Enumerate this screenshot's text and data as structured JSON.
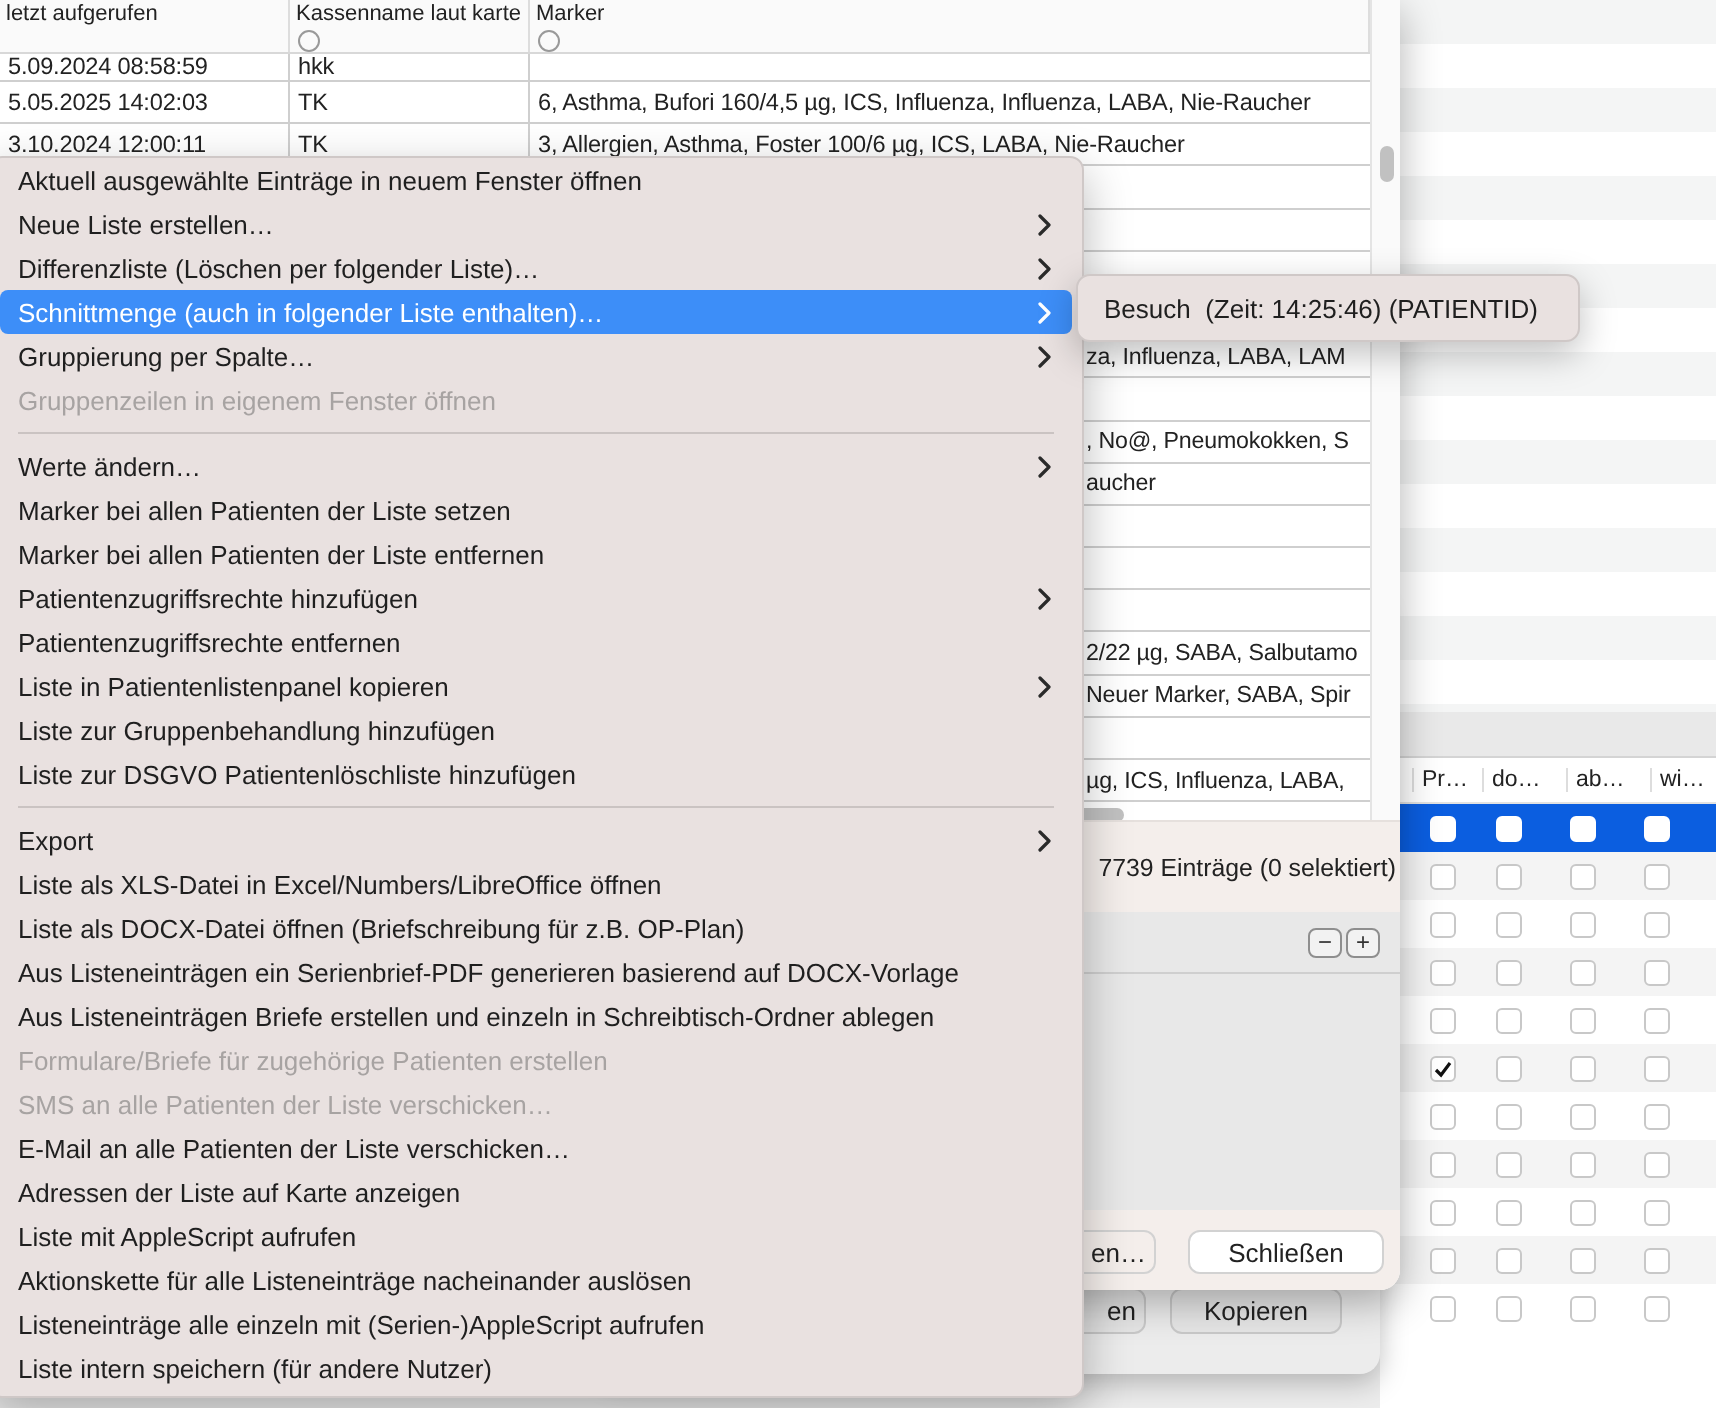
{
  "back_window": {
    "columns": [
      "Pr…",
      "do…",
      "ab…",
      "wi…"
    ],
    "rows": [
      {
        "selected": true,
        "checks": [
          false,
          false,
          false,
          false
        ]
      },
      {
        "selected": false,
        "checks": [
          false,
          false,
          false,
          false
        ]
      },
      {
        "selected": false,
        "checks": [
          false,
          false,
          false,
          false
        ]
      },
      {
        "selected": false,
        "checks": [
          false,
          false,
          false,
          false
        ]
      },
      {
        "selected": false,
        "checks": [
          false,
          false,
          false,
          false
        ]
      },
      {
        "selected": false,
        "checks": [
          true,
          false,
          false,
          false
        ]
      },
      {
        "selected": false,
        "checks": [
          false,
          false,
          false,
          false
        ]
      },
      {
        "selected": false,
        "checks": [
          false,
          false,
          false,
          false
        ]
      },
      {
        "selected": false,
        "checks": [
          false,
          false,
          false,
          false
        ]
      },
      {
        "selected": false,
        "checks": [
          false,
          false,
          false,
          false
        ]
      },
      {
        "selected": false,
        "checks": [
          false,
          false,
          false,
          false
        ]
      }
    ]
  },
  "middle_window": {
    "buttons": [
      "en",
      "Kopieren"
    ]
  },
  "dialog": {
    "columns": [
      "letzt aufgerufen",
      "Kassenname laut karte",
      "Marker"
    ],
    "rows": [
      {
        "kind": "full",
        "date": "5.09.2024 08:58:59",
        "kasse": "hkk"
      },
      {
        "kind": "full",
        "date": "5.05.2025 14:02:03",
        "kasse": "TK",
        "marker": "6, Asthma, Bufori 160/4,5 µg, ICS, Influenza, Influenza, LABA, Nie-Raucher"
      },
      {
        "kind": "full",
        "date": "3.10.2024 12:00:11",
        "kasse": "TK",
        "marker": "3, Allergien, Asthma, Foster 100/6 µg, ICS, LABA, Nie-Raucher"
      },
      {
        "kind": "blank"
      },
      {
        "kind": "blank"
      },
      {
        "kind": "blank"
      },
      {
        "kind": "blank"
      },
      {
        "kind": "partial",
        "marker": "za, Influenza, LABA, LAM"
      },
      {
        "kind": "blank"
      },
      {
        "kind": "partial",
        "marker": ", No@, Pneumokokken, S"
      },
      {
        "kind": "partial",
        "marker": "aucher"
      },
      {
        "kind": "blank"
      },
      {
        "kind": "blank"
      },
      {
        "kind": "blank"
      },
      {
        "kind": "partial",
        "marker": "2/22 µg, SABA, Salbutamo"
      },
      {
        "kind": "partial",
        "marker": "Neuer Marker, SABA, Spir"
      },
      {
        "kind": "blank"
      },
      {
        "kind": "partial",
        "marker": "µg, ICS, Influenza, LABA,"
      }
    ],
    "status": "7739 Einträge (0 selektiert)",
    "tool_buttons": [
      "−",
      "+"
    ],
    "buttons": [
      "en…",
      "Schließen"
    ]
  },
  "menu": {
    "items": [
      {
        "kind": "item",
        "label": "Aktuell ausgewählte Einträge in neuem Fenster öffnen",
        "submenu": false,
        "disabled": false,
        "selected": false
      },
      {
        "kind": "item",
        "label": "Neue Liste erstellen…",
        "submenu": true,
        "disabled": false,
        "selected": false
      },
      {
        "kind": "item",
        "label": "Differenzliste (Löschen per folgender Liste)…",
        "submenu": true,
        "disabled": false,
        "selected": false
      },
      {
        "kind": "item",
        "label": "Schnittmenge (auch in folgender Liste enthalten)…",
        "submenu": true,
        "disabled": false,
        "selected": true
      },
      {
        "kind": "item",
        "label": "Gruppierung per Spalte…",
        "submenu": true,
        "disabled": false,
        "selected": false
      },
      {
        "kind": "item",
        "label": "Gruppenzeilen in eigenem Fenster öffnen",
        "submenu": false,
        "disabled": true,
        "selected": false
      },
      {
        "kind": "separator"
      },
      {
        "kind": "item",
        "label": "Werte ändern…",
        "submenu": true,
        "disabled": false,
        "selected": false
      },
      {
        "kind": "item",
        "label": "Marker bei allen Patienten der Liste setzen",
        "submenu": false,
        "disabled": false,
        "selected": false
      },
      {
        "kind": "item",
        "label": "Marker bei allen Patienten der Liste entfernen",
        "submenu": false,
        "disabled": false,
        "selected": false
      },
      {
        "kind": "item",
        "label": "Patientenzugriffsrechte hinzufügen",
        "submenu": true,
        "disabled": false,
        "selected": false
      },
      {
        "kind": "item",
        "label": "Patientenzugriffsrechte entfernen",
        "submenu": false,
        "disabled": false,
        "selected": false
      },
      {
        "kind": "item",
        "label": "Liste in Patientenlistenpanel kopieren",
        "submenu": true,
        "disabled": false,
        "selected": false
      },
      {
        "kind": "item",
        "label": "Liste zur Gruppenbehandlung hinzufügen",
        "submenu": false,
        "disabled": false,
        "selected": false
      },
      {
        "kind": "item",
        "label": "Liste zur DSGVO Patientenlöschliste hinzufügen",
        "submenu": false,
        "disabled": false,
        "selected": false
      },
      {
        "kind": "separator"
      },
      {
        "kind": "item",
        "label": "Export",
        "submenu": true,
        "disabled": false,
        "selected": false
      },
      {
        "kind": "item",
        "label": "Liste als XLS-Datei in Excel/Numbers/LibreOffice öffnen",
        "submenu": false,
        "disabled": false,
        "selected": false
      },
      {
        "kind": "item",
        "label": "Liste als DOCX-Datei öffnen (Briefschreibung für z.B. OP-Plan)",
        "submenu": false,
        "disabled": false,
        "selected": false
      },
      {
        "kind": "item",
        "label": "Aus Listeneinträgen ein Serienbrief-PDF generieren basierend auf DOCX-Vorlage",
        "submenu": false,
        "disabled": false,
        "selected": false
      },
      {
        "kind": "item",
        "label": "Aus Listeneinträgen Briefe erstellen und einzeln in Schreibtisch-Ordner ablegen",
        "submenu": false,
        "disabled": false,
        "selected": false
      },
      {
        "kind": "item",
        "label": "Formulare/Briefe für zugehörige Patienten erstellen",
        "submenu": false,
        "disabled": true,
        "selected": false
      },
      {
        "kind": "item",
        "label": "SMS an alle Patienten der Liste verschicken…",
        "submenu": false,
        "disabled": true,
        "selected": false
      },
      {
        "kind": "item",
        "label": "E-Mail an alle Patienten der Liste verschicken…",
        "submenu": false,
        "disabled": false,
        "selected": false
      },
      {
        "kind": "item",
        "label": "Adressen der Liste auf Karte anzeigen",
        "submenu": false,
        "disabled": false,
        "selected": false
      },
      {
        "kind": "item",
        "label": "Liste mit AppleScript aufrufen",
        "submenu": false,
        "disabled": false,
        "selected": false
      },
      {
        "kind": "item",
        "label": "Aktionskette für alle Listeneinträge nacheinander auslösen",
        "submenu": false,
        "disabled": false,
        "selected": false
      },
      {
        "kind": "item",
        "label": "Listeneinträge alle einzeln mit (Serien-)AppleScript aufrufen",
        "submenu": false,
        "disabled": false,
        "selected": false
      },
      {
        "kind": "item",
        "label": "Liste intern speichern (für andere Nutzer)",
        "submenu": false,
        "disabled": false,
        "selected": false
      }
    ]
  },
  "submenu": {
    "items": [
      {
        "label": "Besuch  (Zeit: 14:25:46) (PATIENTID)"
      }
    ]
  }
}
